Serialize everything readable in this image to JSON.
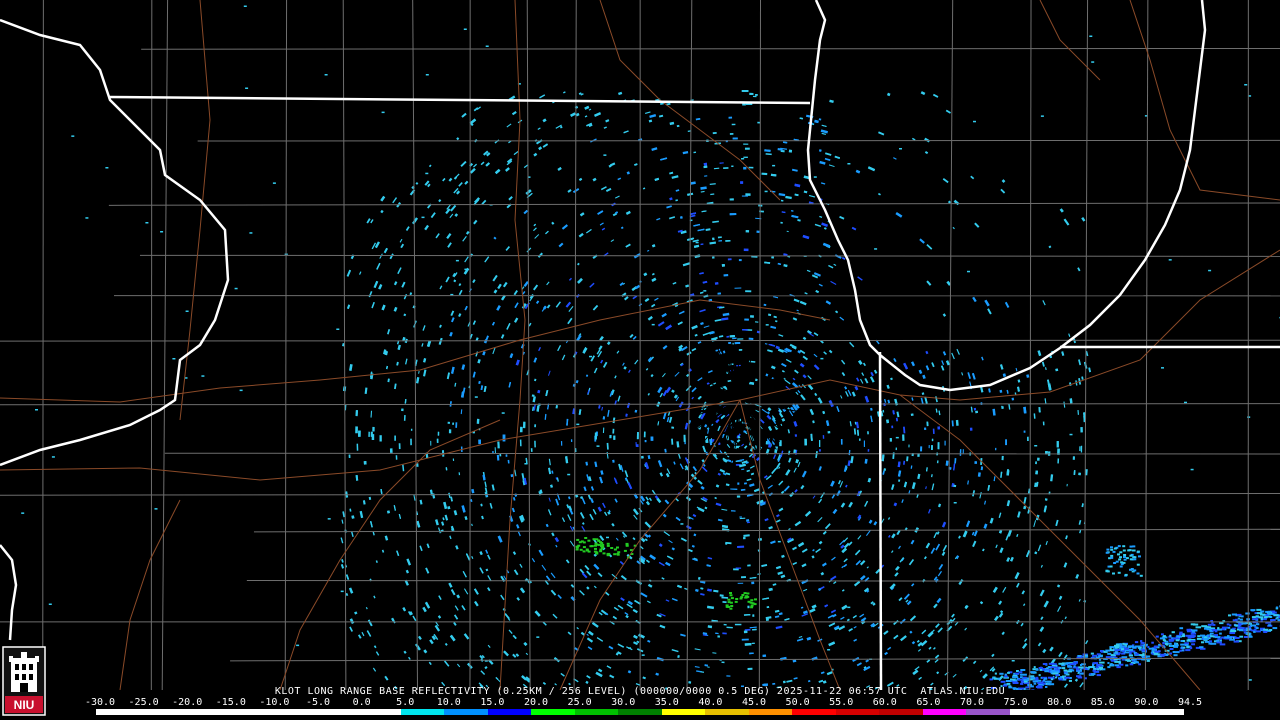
{
  "product": {
    "caption": "KLOT LONG RANGE BASE REFLECTIVITY (0.25KM / 256 LEVEL) (000000/0000 0.5 DEG) 2025-11-22 06:57 UTC  ATLAS.NIU.EDU",
    "radar_site": "KLOT",
    "timestamp": "2025-11-22 06:57 UTC",
    "source": "ATLAS.NIU.EDU"
  },
  "logo": {
    "text": "NIU",
    "icon": "university-tower-logo",
    "color": "#c8102e"
  },
  "color_scale": {
    "tick_labels": [
      "-30.0",
      "-25.0",
      "-20.0",
      "-15.0",
      "-10.0",
      "-5.0",
      "0.0",
      "5.0",
      "10.0",
      "15.0",
      "20.0",
      "25.0",
      "30.0",
      "35.0",
      "40.0",
      "45.0",
      "50.0",
      "55.0",
      "60.0",
      "65.0",
      "70.0",
      "75.0",
      "80.0",
      "85.0",
      "90.0",
      "94.5"
    ],
    "colors": [
      "#ffffff",
      "#ffffff",
      "#ffffff",
      "#ffffff",
      "#ffffff",
      "#ffffff",
      "#ffffff",
      "#00e5ee",
      "#0090ff",
      "#0000ff",
      "#00ff00",
      "#00c000",
      "#008000",
      "#ffff00",
      "#e7c000",
      "#ff9000",
      "#ff0000",
      "#d60000",
      "#c00000",
      "#ff00ff",
      "#9955c9",
      "#ffffff",
      "#ffffff",
      "#ffffff",
      "#ffffff"
    ]
  },
  "map_layers": {
    "state_borders_color": "#ffffff",
    "county_lines_color": "#6e6e6e",
    "highways_color": "#8a4a28",
    "water": "Lake Michigan"
  },
  "echo_colors": {
    "light_blue": "#33ccee",
    "mid_blue": "#1a9cff",
    "blue": "#1f4dff",
    "green": "#22cc22"
  }
}
